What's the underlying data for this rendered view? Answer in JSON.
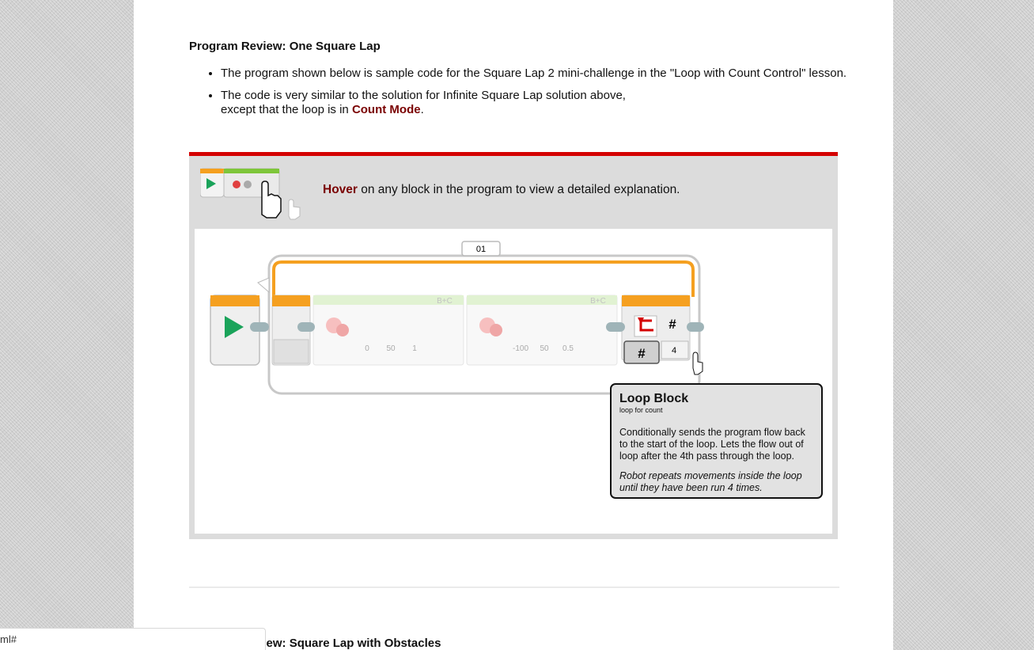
{
  "section": {
    "title": "Program Review: One Square Lap",
    "bullets": [
      {
        "text": "The program shown below is sample code for the Square Lap 2 mini-challenge in the \"Loop with Count Control\" lesson."
      },
      {
        "before": "The code is very similar to the solution for Infinite Square Lap solution above, except that the loop is in ",
        "highlight": "Count Mode",
        "after": "."
      }
    ]
  },
  "hover_banner": {
    "keyword": "Hover",
    "rest": " on any block in the program to view a detailed explanation."
  },
  "program": {
    "loop_label": "01",
    "block1_ports": "B+C",
    "block1_values": [
      "0",
      "50",
      "1"
    ],
    "block2_ports": "B+C",
    "block2_values": [
      "-100",
      "50",
      "0.5"
    ],
    "loop_mode_symbol": "#",
    "loop_count": "4"
  },
  "tooltip": {
    "title": "Loop Block",
    "subtitle": "loop for count",
    "description": "Conditionally sends the program flow back to the start of the loop. Lets the flow out of loop after the 4th pass through the loop.",
    "note": "Robot repeats movements inside the loop until they have been run 4 times."
  },
  "next_section": {
    "title": "Program Review: Square Lap with Obstacles"
  },
  "status_bar": {
    "url": "ml#"
  },
  "colors": {
    "accent_red": "#d40000",
    "highlight": "#7a0000",
    "loop_orange": "#f5a020",
    "start_green": "#1aa35a"
  }
}
